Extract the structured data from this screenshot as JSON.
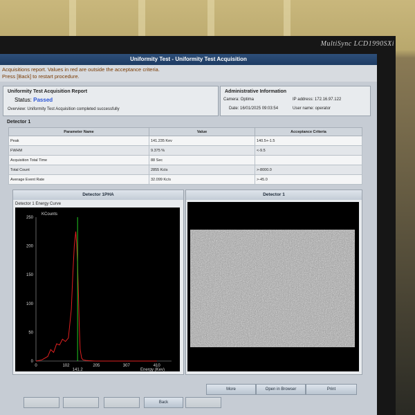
{
  "monitor": {
    "brand": "MultiSync LCD1990SXi"
  },
  "window": {
    "title": "Uniformity Test  - Uniformity Test Acquisition"
  },
  "messages": {
    "line1": "Acquisitions report. Values in red are outside the acceptance criteria.",
    "line2": "Press [Back] to restart procedure."
  },
  "report": {
    "title": "Uniformity Test Acquisition Report",
    "status_label": "Status:",
    "status_value": "Passed",
    "overview": "Overview: Uniformity Test Acquisition completed successfully"
  },
  "admin": {
    "title": "Administrative Information",
    "camera": "Camera: Optima",
    "ip": "IP address: 172.16.97.122",
    "date": "Date: 16/01/2025 09:03:54",
    "user": "User name: operator"
  },
  "detector_section": "Detector 1",
  "table": {
    "headers": [
      "Parameter Name",
      "Value",
      "Acceptance Criteria"
    ],
    "rows": [
      {
        "name": "Peak",
        "value": "141.235 Kev",
        "criteria": "140.5+-1.5"
      },
      {
        "name": "FWHM",
        "value": "9.375 %",
        "criteria": "<-9.5"
      },
      {
        "name": "Acquisition Total Time",
        "value": "88 Sec",
        "criteria": ""
      },
      {
        "name": "Total Count",
        "value": "2855 Kcts",
        "criteria": ">-8000.0"
      },
      {
        "name": "Average Event Rate",
        "value": "32.099 Kc/s",
        "criteria": ">-45.0"
      }
    ]
  },
  "left_panel": {
    "header": "Detector 1PHA",
    "subtitle": "Detector 1 Energy Curve"
  },
  "right_panel": {
    "header": "Detector 1"
  },
  "colors": {
    "title_bar": "#1d3b63",
    "status_passed": "#2b55d6",
    "plot_bg": "#000000",
    "energy_curve": "#e02020",
    "peak_marker": "#22cc22",
    "axis_label": "#e0c020"
  },
  "chart_data": {
    "type": "line",
    "title": "Detector 1 Energy Curve",
    "xlabel": "Energy (Kev)",
    "ylabel": "KCounts",
    "xlim": [
      0,
      460
    ],
    "ylim": [
      0,
      250
    ],
    "x_ticks": [
      "0",
      "102",
      "205",
      "307",
      "410"
    ],
    "y_ticks": [
      "0",
      "50",
      "100",
      "150",
      "200",
      "250"
    ],
    "peak_marker_label": "141.2",
    "series": [
      {
        "x": [
          0,
          20,
          40,
          50,
          60,
          70,
          80,
          90,
          100,
          110,
          120,
          125,
          130,
          135,
          138,
          141,
          144,
          147,
          150,
          155,
          160,
          170,
          200,
          300,
          410
        ],
        "y": [
          0,
          2,
          8,
          20,
          15,
          30,
          28,
          38,
          34,
          40,
          90,
          150,
          200,
          225,
          205,
          170,
          120,
          60,
          20,
          5,
          2,
          1,
          0,
          0,
          0
        ]
      }
    ],
    "peak_marker_x": 141.2,
    "peak_marker_y": 250
  },
  "buttons": {
    "more": "More",
    "open_browser": "Open in Browser",
    "print": "Print",
    "back": "Back"
  }
}
